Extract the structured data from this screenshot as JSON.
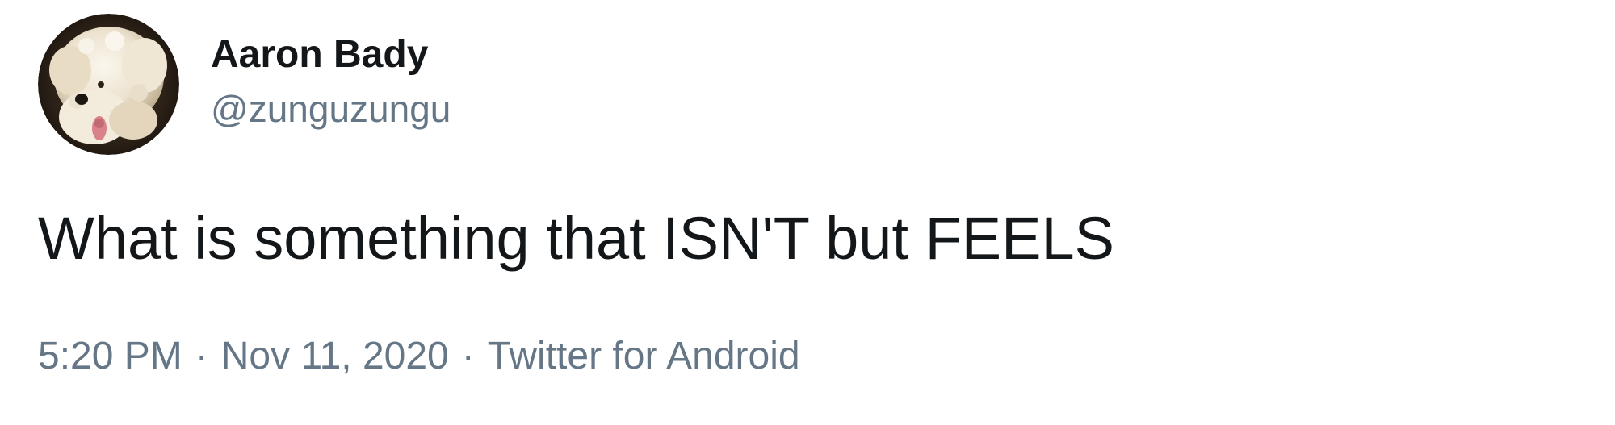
{
  "tweet": {
    "author": {
      "display_name": "Aaron Bady",
      "handle": "@zunguzungu",
      "avatar_icon": "dog-avatar-icon"
    },
    "text": "What is something that ISN'T but FEELS",
    "meta": {
      "time": "5:20 PM",
      "date": "Nov 11, 2020",
      "source": "Twitter for Android",
      "separator": "·"
    }
  },
  "colors": {
    "primary_text": "#14171a",
    "secondary_text": "#657786",
    "background": "#ffffff"
  }
}
